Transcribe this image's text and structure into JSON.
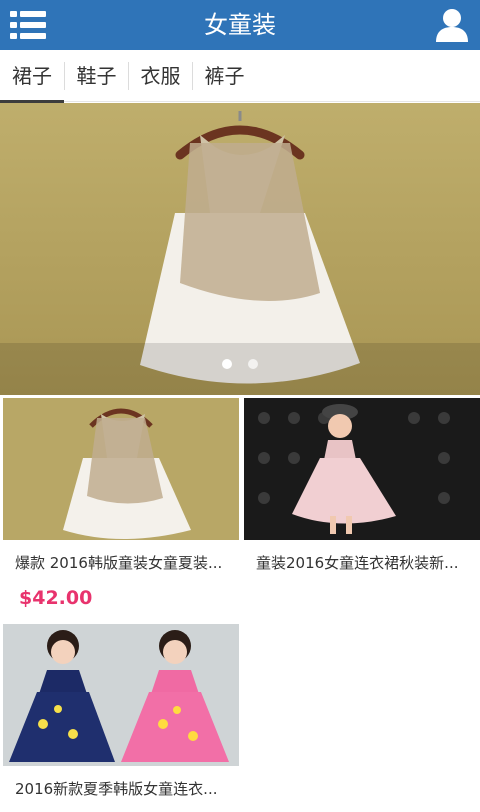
{
  "header": {
    "title": "女童装",
    "menu_icon": "list-menu-icon",
    "user_icon": "user-icon"
  },
  "tabs": [
    {
      "label": "裙子"
    },
    {
      "label": "鞋子"
    },
    {
      "label": "衣服"
    },
    {
      "label": "裤子"
    }
  ],
  "banner": {
    "slide_count": 2,
    "active_slide": 1
  },
  "products": [
    {
      "name": "爆款 2016韩版童装女童夏装...",
      "price": "$42.00"
    },
    {
      "name": "童装2016女童连衣裙秋装新...",
      "price": ""
    },
    {
      "name": "2016新款夏季韩版女童连衣...",
      "price": ""
    }
  ],
  "colors": {
    "header_bg": "#2f74b8",
    "price": "#e8336d"
  }
}
